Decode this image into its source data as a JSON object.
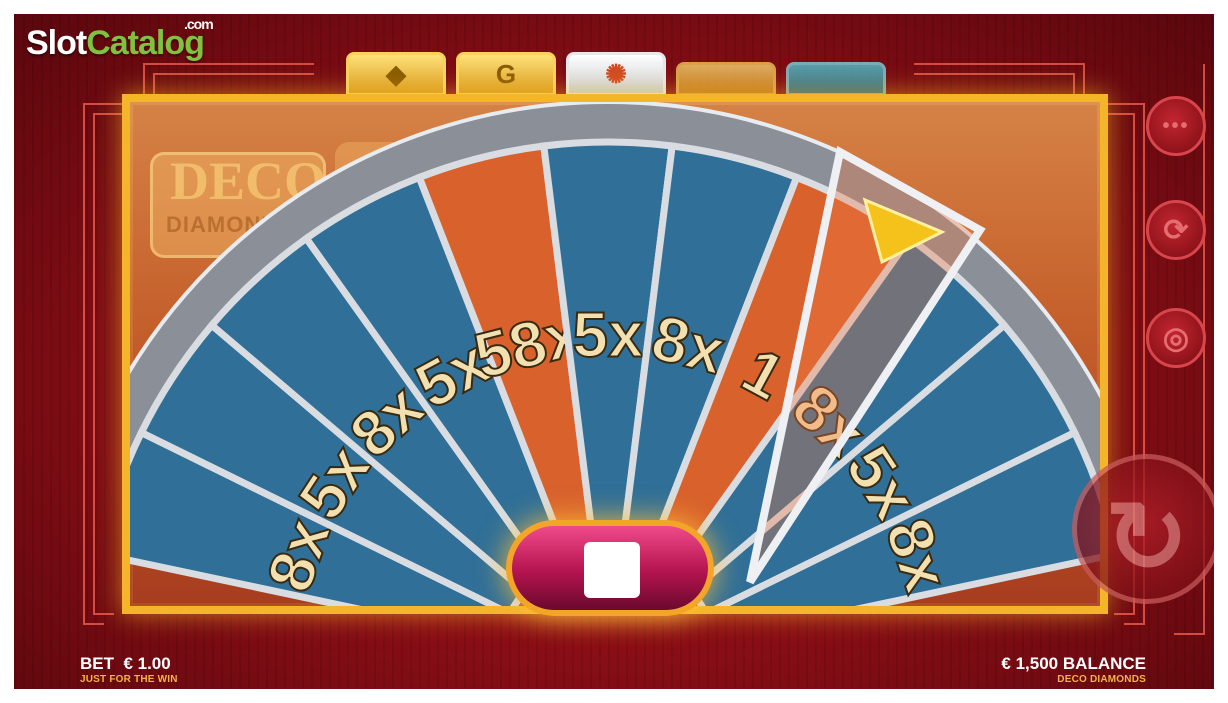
{
  "watermark": {
    "part1": "Slot",
    "part2": "Catalog",
    "domain": ".com"
  },
  "tabs": [
    {
      "icon": "diamond-icon",
      "label": "◆"
    },
    {
      "icon": "g-icon",
      "label": "G"
    },
    {
      "icon": "wheel-icon",
      "label": "✺"
    },
    {
      "icon": "bar-icon",
      "label": ""
    },
    {
      "icon": "gem-icon",
      "label": ""
    }
  ],
  "logo": {
    "title": "DECO",
    "subtitle": "DIAMONDS"
  },
  "wheel": {
    "segments": [
      {
        "text": "8x",
        "color": "blue"
      },
      {
        "text": "5x",
        "color": "blue"
      },
      {
        "text": "8x",
        "color": "blue"
      },
      {
        "text": "5x",
        "color": "blue"
      },
      {
        "text": "58x",
        "color": "orange"
      },
      {
        "text": "5x",
        "color": "blue"
      },
      {
        "text": "8x",
        "color": "blue"
      },
      {
        "text": "1",
        "color": "orange"
      },
      {
        "text": "8x",
        "color": "blue"
      },
      {
        "text": "5x",
        "color": "blue"
      },
      {
        "text": "8x",
        "color": "blue"
      }
    ]
  },
  "controls": {
    "menu_icon": "more-icon",
    "autoplay_icon": "autoplay-icon",
    "chip_icon": "chip-icon",
    "spin_icon": "spin-icon",
    "menu_glyph": "•••",
    "autoplay_glyph": "⟳",
    "chip_glyph": "◎",
    "spin_glyph": "↻"
  },
  "bet": {
    "label": "BET",
    "value": "€ 1.00",
    "caption": "JUST FOR THE WIN"
  },
  "balance": {
    "value": "€ 1,500",
    "label": "BALANCE",
    "caption": "DECO DIAMONDS"
  },
  "colors": {
    "gold": "#f5b52a",
    "blue_segment": "#2f6f98",
    "orange_segment": "#d8612c",
    "cream_text": "#f3e0b0"
  }
}
